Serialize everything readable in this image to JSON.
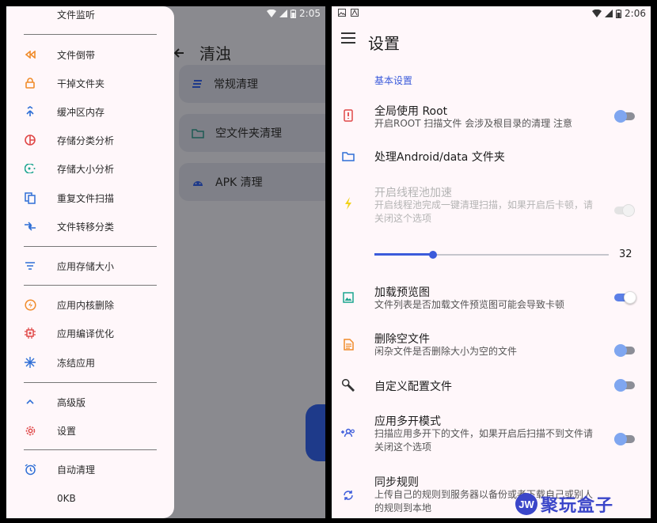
{
  "left": {
    "status_time": "2:05",
    "screen_title": "清浊",
    "cards": [
      {
        "label": "常规清理",
        "icon": "list-icon"
      },
      {
        "label": "空文件夹清理",
        "icon": "folder-icon"
      },
      {
        "label": "APK 清理",
        "icon": "android-icon"
      }
    ],
    "drawer": {
      "top_item": {
        "label": "文件监听",
        "icon": "file-watch-icon"
      },
      "group1": [
        {
          "label": "文件倒带",
          "icon": "rewind-icon"
        },
        {
          "label": "干掉文件夹",
          "icon": "lock-icon"
        },
        {
          "label": "缓冲区内存",
          "icon": "merge-icon"
        },
        {
          "label": "存储分类分析",
          "icon": "pie-chart-icon"
        },
        {
          "label": "存储大小分析",
          "icon": "storage-size-icon"
        },
        {
          "label": "重复文件扫描",
          "icon": "copy-icon"
        },
        {
          "label": "文件转移分类",
          "icon": "transfer-icon"
        }
      ],
      "group2": [
        {
          "label": "应用存储大小",
          "icon": "filter-icon"
        }
      ],
      "group3": [
        {
          "label": "应用内核删除",
          "icon": "bolt-circle-icon"
        },
        {
          "label": "应用编译优化",
          "icon": "chip-icon"
        },
        {
          "label": "冻结应用",
          "icon": "snowflake-icon"
        }
      ],
      "group4": [
        {
          "label": "高级版",
          "icon": "chevron-up-icon"
        },
        {
          "label": "设置",
          "icon": "gear-icon"
        }
      ],
      "group5": [
        {
          "label": "自动清理",
          "icon": "alarm-icon"
        },
        {
          "label": "0KB",
          "icon": ""
        }
      ]
    }
  },
  "right": {
    "status_time": "2:06",
    "title": "设置",
    "section": "基本设置",
    "settings": [
      {
        "title": "全局使用 Root",
        "subtitle": "开启ROOT 扫描文件 会涉及根目录的清理 注意",
        "icon": "root-icon",
        "toggle": "off"
      },
      {
        "title": "处理Android/data 文件夹",
        "subtitle": "",
        "icon": "folder-icon",
        "toggle": "none"
      },
      {
        "title": "开启线程池加速",
        "subtitle": "开启线程池完成一键清理扫描，如果开启后卡顿，请关闭这个选项",
        "icon": "bolt-icon",
        "toggle": "disabled"
      },
      {
        "title": "加载预览图",
        "subtitle": "文件列表是否加载文件预览图可能会导致卡顿",
        "icon": "image-icon",
        "toggle": "on"
      },
      {
        "title": "删除空文件",
        "subtitle": "闲杂文件是否删除大小为空的文件",
        "icon": "document-icon",
        "toggle": "off"
      },
      {
        "title": "自定义配置文件",
        "subtitle": "",
        "icon": "wrench-icon",
        "toggle": "off"
      },
      {
        "title": "应用多开模式",
        "subtitle": "扫描应用多开下的文件，如果开启后扫描不到文件请关闭这个选项",
        "icon": "group-add-icon",
        "toggle": "off"
      },
      {
        "title": "同步规则",
        "subtitle": "上传自己的规则到服务器以备份或者下载自己或别人的规则到本地",
        "icon": "sync-icon",
        "toggle": "none"
      }
    ],
    "slider": {
      "value": 32,
      "fraction": 0.25
    },
    "watermark": {
      "logo": "JW",
      "text": "聚玩盒子"
    }
  },
  "colors": {
    "accent": "#3b5bdb",
    "orange": "#f08c2b",
    "red": "#e04848",
    "teal": "#1aa58f",
    "blue": "#2f6fd6",
    "drawer_bg": "#fff7fa"
  }
}
